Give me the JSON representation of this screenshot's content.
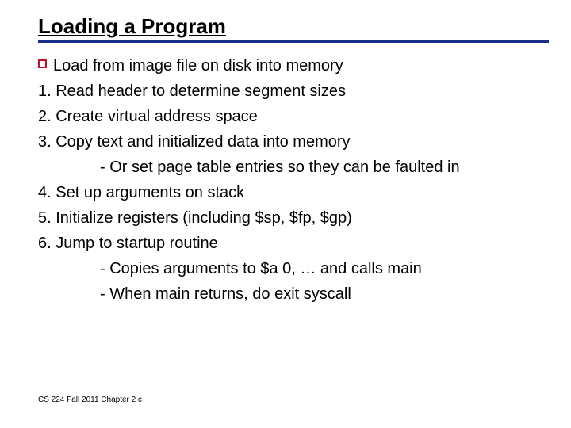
{
  "title": "Loading a Program",
  "lead": "Load from image file on disk into memory",
  "items": {
    "n1": "1. Read header to determine segment sizes",
    "n2": "2. Create virtual address space",
    "n3": "3. Copy text and initialized data into memory",
    "s3a": "- Or set page table entries so they can be faulted in",
    "n4": "4. Set up arguments on stack",
    "n5": "5. Initialize registers (including $sp, $fp, $gp)",
    "n6": "6. Jump to startup routine",
    "s6a": "- Copies arguments to $a 0, … and calls main",
    "s6b": "- When main returns, do exit syscall"
  },
  "footer": "CS 224 Fall 2011 Chapter 2 c"
}
